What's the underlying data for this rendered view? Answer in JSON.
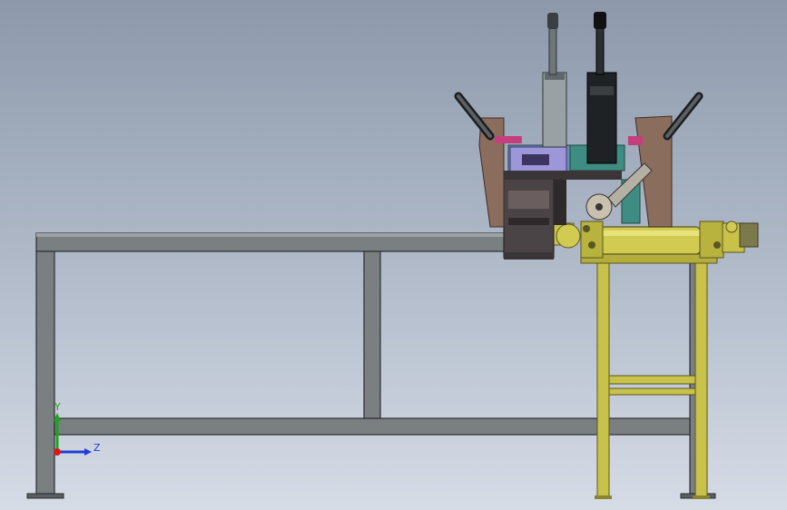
{
  "viewport": {
    "colors": {
      "frame": "#6d7275",
      "frame_dark": "#3b3f42",
      "yellow": "#c8c24a",
      "yellow_dark": "#8a852d",
      "brown": "#8a6d5d",
      "teal": "#3f8d82",
      "pink": "#c53e7e",
      "lavender": "#9d96d8"
    }
  },
  "triad": {
    "y_label": "Y",
    "z_label": "Z",
    "y_color": "#1aa51a",
    "z_color": "#1f3dd6",
    "origin_color": "#d41b1b"
  }
}
